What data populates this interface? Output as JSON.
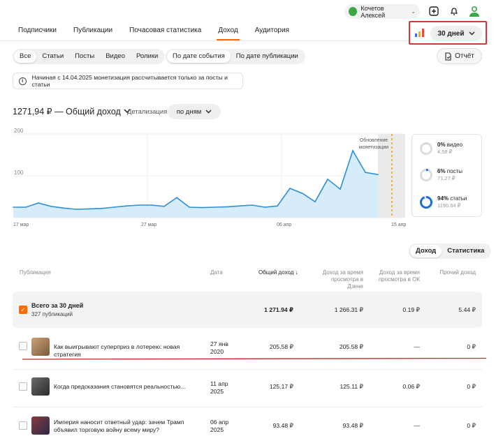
{
  "user": {
    "name": "Кочетов Алексей"
  },
  "nav": {
    "tabs": [
      {
        "label": "Подписчики",
        "active": false
      },
      {
        "label": "Публикации",
        "active": false
      },
      {
        "label": "Почасовая статистика",
        "active": false
      },
      {
        "label": "Доход",
        "active": true
      },
      {
        "label": "Аудитория",
        "active": false
      }
    ]
  },
  "period": {
    "label": "30 дней"
  },
  "filters": {
    "types": [
      "Все",
      "Статьи",
      "Посты",
      "Видео",
      "Ролики"
    ],
    "dates": [
      "По дате события",
      "По дате публикации"
    ]
  },
  "report_button": "Отчёт",
  "notice": "Начиная с 14.04.2025 монетизация рассчитывается только за посты и статьи",
  "income": {
    "title": "1271,94 ₽ — Общий доход",
    "detail_label": "Детализация",
    "detail_value": "по дням"
  },
  "chart_data": {
    "type": "area",
    "yticks": [
      "200",
      "100",
      "0"
    ],
    "ylim": [
      0,
      200
    ],
    "x_labels": [
      "17 мар",
      "27 мар",
      "06 апр",
      "15 апр"
    ],
    "values": [
      25,
      25,
      35,
      27,
      23,
      20,
      21,
      22,
      25,
      28,
      30,
      30,
      27,
      48,
      25,
      24,
      25,
      26,
      28,
      30,
      25,
      28,
      70,
      58,
      38,
      92,
      68,
      160,
      108,
      103
    ],
    "annotation": "Обновление монетизации",
    "color": "#2d8fd5",
    "fill": "#d6ecfb"
  },
  "share": [
    {
      "pct": "0%",
      "label": "видео",
      "amount": "4,58 ₽",
      "value": 0.004
    },
    {
      "pct": "6%",
      "label": "посты",
      "amount": "71,27 ₽",
      "value": 0.06
    },
    {
      "pct": "94%",
      "label": "статьи",
      "amount": "1190,64 ₽",
      "value": 0.94
    }
  ],
  "table_toggle": [
    "Доход",
    "Статистика"
  ],
  "table": {
    "headers": {
      "pub": "Публикация",
      "date": "Дата",
      "total": "Общий доход",
      "zen": "Доход за время просмотра в Дзене",
      "ok": "Доход за время просмотра в ОК",
      "other": "Прочий доход"
    },
    "total": {
      "title": "Всего за 30 дней",
      "subtitle": "327 публикаций",
      "total": "1 271.94 ₽",
      "zen": "1 266.31 ₽",
      "ok": "0.19 ₽",
      "other": "5.44 ₽"
    },
    "rows": [
      {
        "title": "Как выигрывают суперприз в лотерею: новая стратегия",
        "date": "27 янв 2020",
        "total": "205.58 ₽",
        "zen": "205.58 ₽",
        "ok": "—",
        "other": "0 ₽"
      },
      {
        "title": "Когда предсказания становятся реальностью...",
        "date": "11 апр 2025",
        "total": "125.17 ₽",
        "zen": "125.11 ₽",
        "ok": "0.06 ₽",
        "other": "0 ₽"
      },
      {
        "title": "Империя наносит ответный удар: зачем Трамп объявил торговую войну всему миру?",
        "date": "06 апр 2025",
        "total": "93.48 ₽",
        "zen": "93.48 ₽",
        "ok": "—",
        "other": "0 ₽"
      }
    ]
  }
}
